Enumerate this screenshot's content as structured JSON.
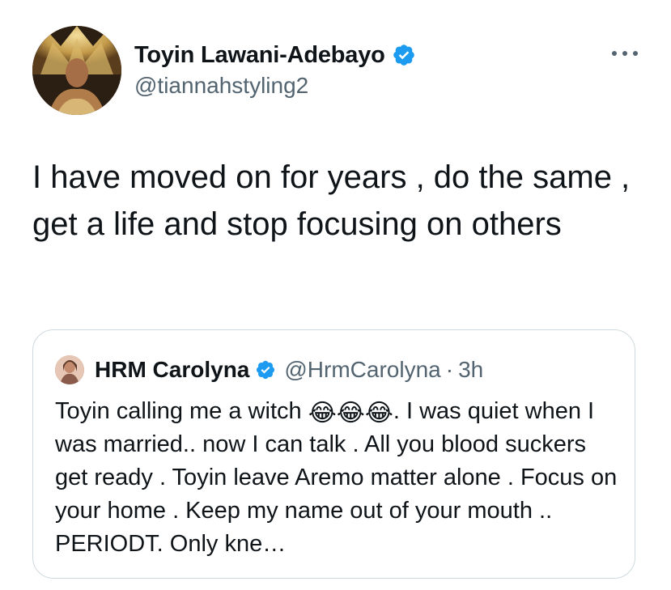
{
  "tweet": {
    "author": {
      "display_name": "Toyin Lawani-Adebayo",
      "handle": "@tiannahstyling2",
      "verified": true
    },
    "text": "I have moved on for years , do the same , get a life and stop focusing on others",
    "more_icon": "more-horizontal-icon"
  },
  "quote": {
    "author": {
      "display_name": "HRM Carolyna",
      "handle": "@HrmCarolyna",
      "separator": "·",
      "time": "3h",
      "verified": true
    },
    "text_before_emoji": "Toyin calling me a witch ",
    "emoji": [
      "😂",
      "😂",
      "😂"
    ],
    "text_after_emoji": ". I was quiet when I was married.. now I can talk . All you blood suckers get ready . Toyin leave Aremo matter  alone . Focus on your home . Keep my name out of your mouth .. PERIODT.  Only kne…"
  },
  "colors": {
    "text_primary": "#0f1419",
    "text_secondary": "#536471",
    "verified_blue": "#1d9bf0",
    "border": "#cfd9de"
  }
}
